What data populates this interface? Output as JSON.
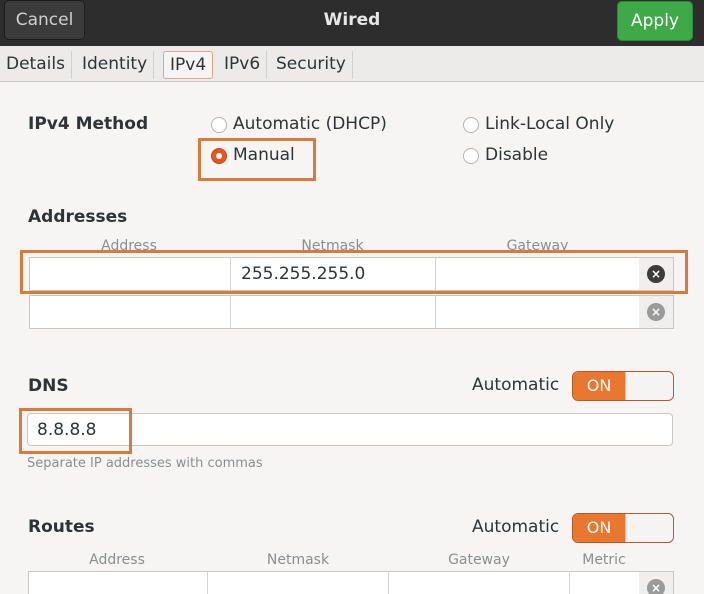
{
  "header": {
    "cancel_label": "Cancel",
    "title": "Wired",
    "apply_label": "Apply"
  },
  "tabs": [
    {
      "label": "Details"
    },
    {
      "label": "Identity"
    },
    {
      "label": "IPv4",
      "active": true
    },
    {
      "label": "IPv6"
    },
    {
      "label": "Security"
    }
  ],
  "ipv4_method": {
    "label": "IPv4 Method",
    "options": [
      {
        "label": "Automatic (DHCP)",
        "selected": false
      },
      {
        "label": "Link-Local Only",
        "selected": false
      },
      {
        "label": "Manual",
        "selected": true
      },
      {
        "label": "Disable",
        "selected": false
      }
    ]
  },
  "addresses": {
    "label": "Addresses",
    "columns": [
      "Address",
      "Netmask",
      "Gateway"
    ],
    "rows": [
      {
        "address": "",
        "netmask": "255.255.255.0",
        "gateway": ""
      },
      {
        "address": "",
        "netmask": "",
        "gateway": ""
      }
    ]
  },
  "dns": {
    "label": "DNS",
    "automatic_label": "Automatic",
    "switch_label": "ON",
    "value": "8.8.8.8",
    "hint": "Separate IP addresses with commas"
  },
  "routes": {
    "label": "Routes",
    "automatic_label": "Automatic",
    "switch_label": "ON",
    "columns": [
      "Address",
      "Netmask",
      "Gateway",
      "Metric"
    ]
  },
  "colors": {
    "accent": "#e9772f",
    "apply_green": "#3daa47",
    "annotation": "#d77a3a"
  },
  "icons": {
    "delete_row": "×"
  }
}
